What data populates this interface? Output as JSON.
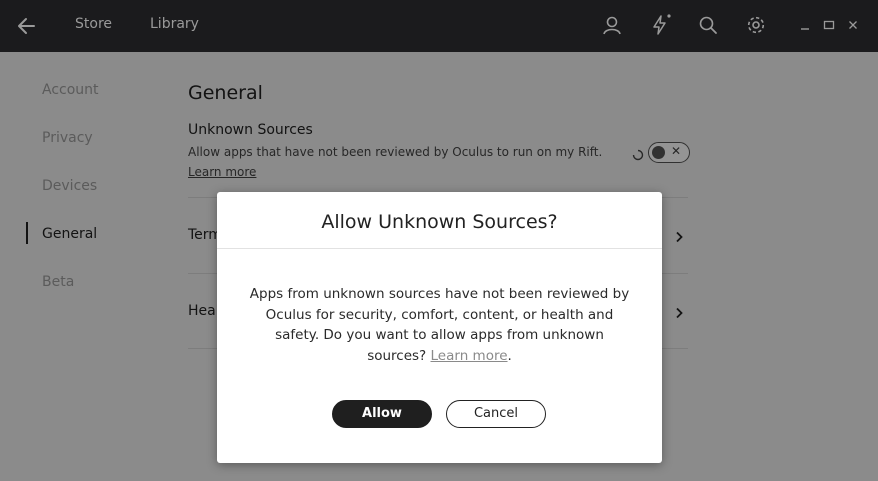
{
  "topbar": {
    "nav_store": "Store",
    "nav_library": "Library"
  },
  "sidebar": {
    "items": [
      {
        "label": "Account"
      },
      {
        "label": "Privacy"
      },
      {
        "label": "Devices"
      },
      {
        "label": "General",
        "active": true
      },
      {
        "label": "Beta"
      }
    ]
  },
  "content": {
    "title": "General",
    "unknown_sources": {
      "title": "Unknown Sources",
      "description": "Allow apps that have not been reviewed by Oculus to run on my Rift.",
      "link": "Learn more",
      "link_suffix": ".",
      "toggle_on": false
    },
    "rows": [
      {
        "label": "Term"
      },
      {
        "label": "Heal"
      }
    ]
  },
  "modal": {
    "title": "Allow Unknown Sources?",
    "body_text": "Apps from unknown sources have not been reviewed by Oculus for security, comfort, content, or health and safety. Do you want to allow apps from unknown sources?",
    "body_link": "Learn more",
    "body_suffix": ".",
    "allow_label": "Allow",
    "cancel_label": "Cancel"
  },
  "icons": {
    "back": "arrow-left-icon",
    "profile": "user-icon",
    "notifications": "lightning-icon",
    "search": "search-icon",
    "settings": "gear-icon",
    "minimize": "minimize-icon",
    "maximize": "maximize-icon",
    "close": "close-icon"
  }
}
